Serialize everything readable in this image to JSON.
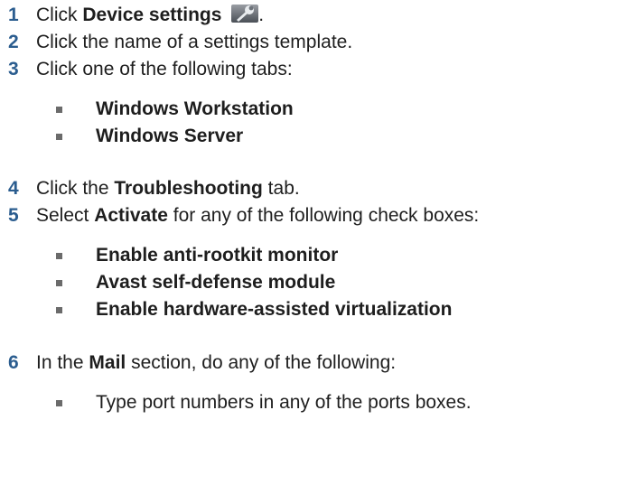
{
  "steps": [
    {
      "num": "1",
      "pre": "Click ",
      "bold": "Device settings",
      "post": "."
    },
    {
      "num": "2",
      "text": "Click the name of a settings template."
    },
    {
      "num": "3",
      "text": "Click one of the following tabs:"
    },
    {
      "num": "4",
      "pre": "Click the ",
      "bold": "Troubleshooting",
      "post": " tab."
    },
    {
      "num": "5",
      "pre": "Select ",
      "bold": "Activate",
      "post": " for any of the following check boxes:"
    },
    {
      "num": "6",
      "pre": "In the ",
      "bold": "Mail",
      "post": " section, do any of the following:"
    }
  ],
  "tabs": [
    "Windows Workstation",
    "Windows Server"
  ],
  "checkboxes": [
    "Enable anti-rootkit monitor",
    "Avast self-defense module",
    "Enable hardware-assisted virtualization"
  ],
  "mail_options": [
    "Type port numbers in any of the ports boxes."
  ],
  "icons": {
    "device_settings": "wrench-icon"
  }
}
